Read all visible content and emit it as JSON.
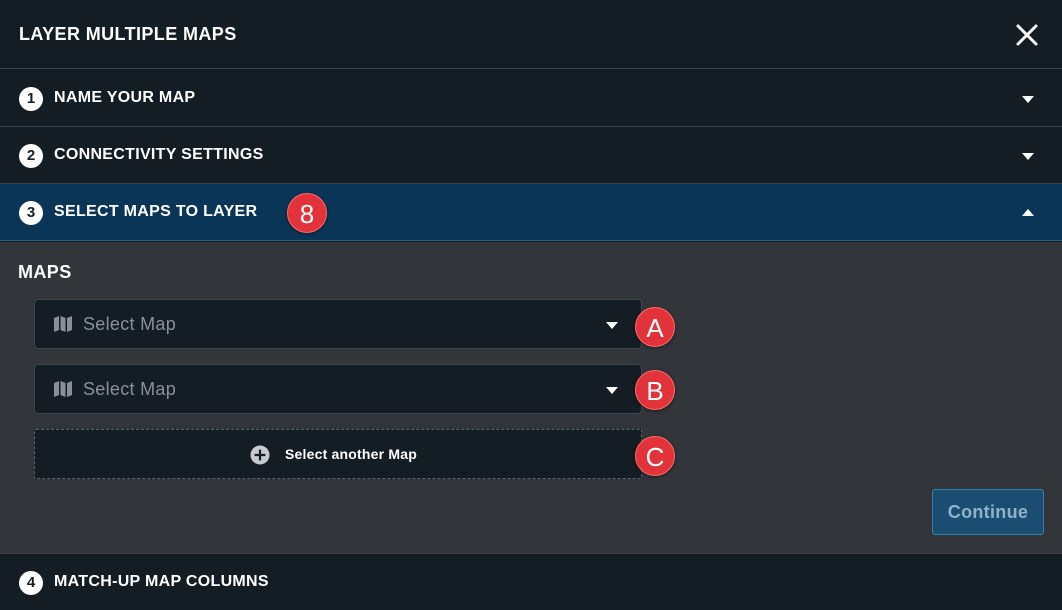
{
  "header": {
    "title": "LAYER MULTIPLE MAPS",
    "close_icon": "close-icon"
  },
  "steps": [
    {
      "num": "1",
      "label": "NAME YOUR MAP",
      "state": "collapsed"
    },
    {
      "num": "2",
      "label": "CONNECTIVITY SETTINGS",
      "state": "collapsed"
    },
    {
      "num": "3",
      "label": "SELECT MAPS TO LAYER",
      "state": "expanded"
    },
    {
      "num": "4",
      "label": "MATCH-UP MAP COLUMNS",
      "state": "collapsed"
    }
  ],
  "callouts": {
    "step3": "8",
    "a": "A",
    "b": "B",
    "c": "C"
  },
  "maps_section": {
    "title": "MAPS",
    "selects": [
      {
        "placeholder": "Select Map",
        "icon": "map-icon"
      },
      {
        "placeholder": "Select Map",
        "icon": "map-icon"
      }
    ],
    "add_label": "Select another Map",
    "add_icon": "plus-circle-icon"
  },
  "continue_label": "Continue",
  "colors": {
    "background": "#151d24",
    "active_step": "#0b3557",
    "panel": "#32353a",
    "callout": "#e2333a",
    "primary_button": "#1c4d72"
  }
}
